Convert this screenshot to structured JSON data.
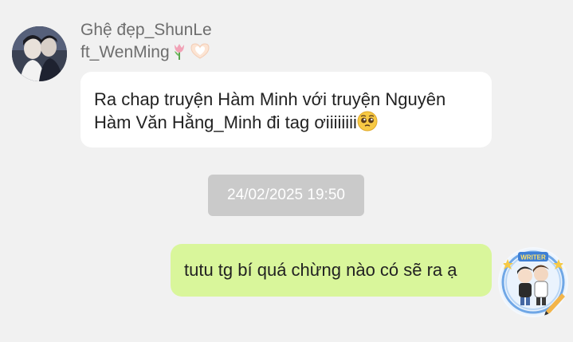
{
  "incoming_message": {
    "sender": "Ghệ đẹp_ShunLe\nft_WenMing",
    "sender_emojis": [
      "tulip-icon",
      "heart-hands-icon"
    ],
    "text": "Ra chap truyện Hàm Minh với truyện Nguyên Hàm Văn Hằng_Minh đi tag ơiiiiiiii",
    "text_emoji": "pleading-face-icon"
  },
  "timestamp": "24/02/2025 19:50",
  "outgoing_message": {
    "text": "tutu tg bí quá chừng nào có sẽ ra ạ",
    "badge_text": "WRITER"
  },
  "colors": {
    "background": "#f1f1f1",
    "incoming_bubble": "#ffffff",
    "outgoing_bubble": "#d9f69b",
    "timestamp_pill": "#cacaca",
    "sender_name": "#6e6e6e"
  }
}
